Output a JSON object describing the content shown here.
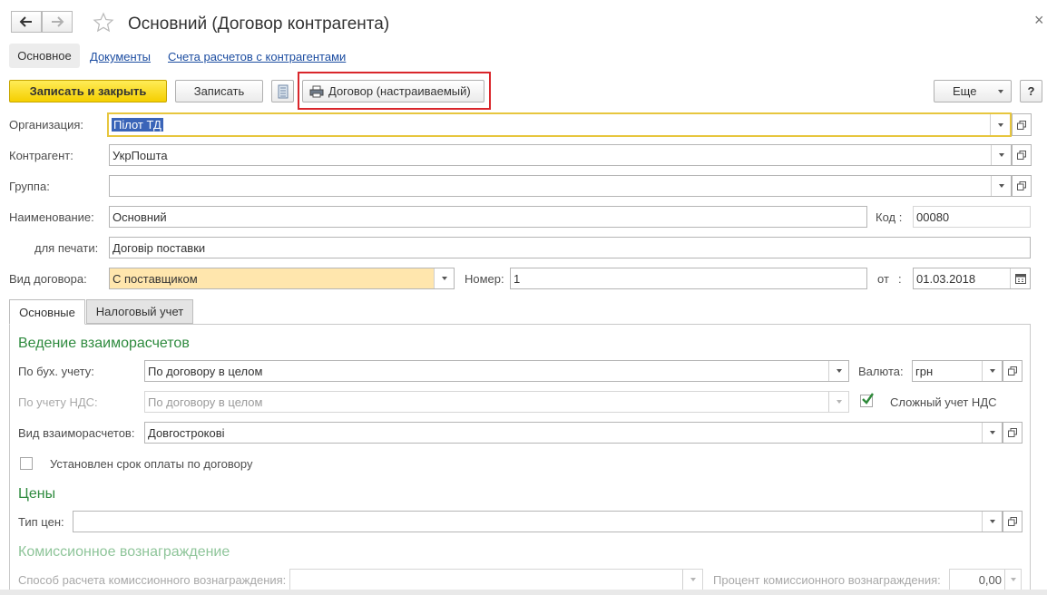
{
  "window": {
    "title": "Основний (Договор контрагента)",
    "close_glyph": "×"
  },
  "nav_tabs": [
    {
      "label": "Основное"
    },
    {
      "label": "Документы"
    },
    {
      "label": "Счета расчетов с контрагентами"
    }
  ],
  "toolbar": {
    "save_close_label": "Записать и закрыть",
    "save_label": "Записать",
    "print_contract_label": "Договор (настраиваемый)",
    "more_label": "Еще",
    "help_label": "?"
  },
  "form": {
    "organization": {
      "label": "Организация:",
      "value": "Пiлот ТД"
    },
    "counterparty": {
      "label": "Контрагент:",
      "value": "УкрПошта"
    },
    "group": {
      "label": "Группа:",
      "value": ""
    },
    "name": {
      "label": "Наименование:",
      "value": "Основний"
    },
    "code": {
      "label": "Код :",
      "value": "00080"
    },
    "print_name": {
      "label": "для печати:",
      "value": "Договiр поставки"
    },
    "contract_type": {
      "label": "Вид договора:",
      "value": "С поставщиком"
    },
    "number": {
      "label": "Номер:",
      "value": "1"
    },
    "date": {
      "label": "от",
      "colon": ":",
      "value": "01.03.2018"
    }
  },
  "tabs": [
    {
      "label": "Основные"
    },
    {
      "label": "Налоговый учет"
    }
  ],
  "settlements": {
    "heading": "Ведение взаиморасчетов",
    "accounting": {
      "label": "По бух. учету:",
      "value": "По договору в целом"
    },
    "vat": {
      "label": "По учету НДС:",
      "value": "По договору в целом"
    },
    "currency": {
      "label": "Валюта:",
      "value": "грн"
    },
    "complex_vat": {
      "label": "Сложный учет НДС",
      "checked": true
    },
    "settlement_type": {
      "label": "Вид взаиморасчетов:",
      "value": "Довгостроковi"
    },
    "payment_term": {
      "label": "Установлен срок оплаты по договору",
      "checked": false
    }
  },
  "prices": {
    "heading": "Цены",
    "price_type": {
      "label": "Тип цен:",
      "value": ""
    }
  },
  "commission": {
    "heading": "Комиссионное вознаграждение",
    "method": {
      "label": "Способ расчета комиссионного вознаграждения:",
      "value": ""
    },
    "percent": {
      "label": "Процент комиссионного вознаграждения:",
      "value": "0,00"
    }
  },
  "colors": {
    "accent_yellow": "#f5cf00",
    "section_green": "#2f8b3f",
    "link_blue": "#1c4da1",
    "highlight_red": "#d9262b",
    "selected_field": "#ffe6ad"
  }
}
